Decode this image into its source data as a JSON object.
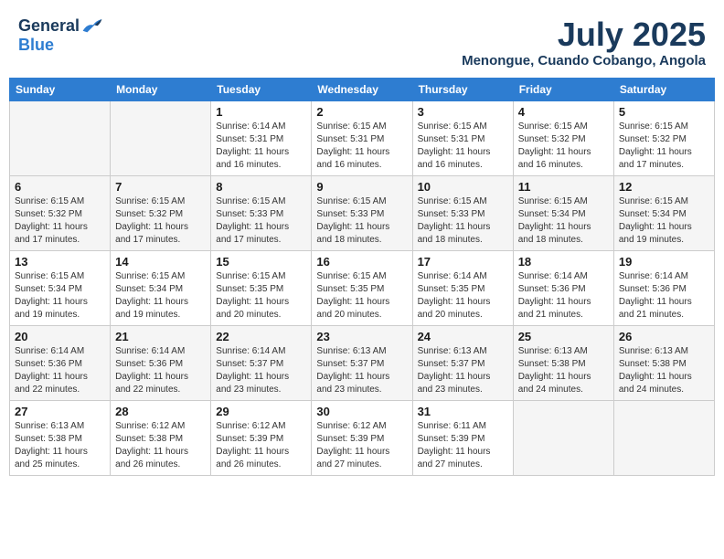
{
  "header": {
    "logo_general": "General",
    "logo_blue": "Blue",
    "month_title": "July 2025",
    "location": "Menongue, Cuando Cobango, Angola"
  },
  "weekdays": [
    "Sunday",
    "Monday",
    "Tuesday",
    "Wednesday",
    "Thursday",
    "Friday",
    "Saturday"
  ],
  "weeks": [
    [
      {
        "day": "",
        "info": ""
      },
      {
        "day": "",
        "info": ""
      },
      {
        "day": "1",
        "info": "Sunrise: 6:14 AM\nSunset: 5:31 PM\nDaylight: 11 hours and 16 minutes."
      },
      {
        "day": "2",
        "info": "Sunrise: 6:15 AM\nSunset: 5:31 PM\nDaylight: 11 hours and 16 minutes."
      },
      {
        "day": "3",
        "info": "Sunrise: 6:15 AM\nSunset: 5:31 PM\nDaylight: 11 hours and 16 minutes."
      },
      {
        "day": "4",
        "info": "Sunrise: 6:15 AM\nSunset: 5:32 PM\nDaylight: 11 hours and 16 minutes."
      },
      {
        "day": "5",
        "info": "Sunrise: 6:15 AM\nSunset: 5:32 PM\nDaylight: 11 hours and 17 minutes."
      }
    ],
    [
      {
        "day": "6",
        "info": "Sunrise: 6:15 AM\nSunset: 5:32 PM\nDaylight: 11 hours and 17 minutes."
      },
      {
        "day": "7",
        "info": "Sunrise: 6:15 AM\nSunset: 5:32 PM\nDaylight: 11 hours and 17 minutes."
      },
      {
        "day": "8",
        "info": "Sunrise: 6:15 AM\nSunset: 5:33 PM\nDaylight: 11 hours and 17 minutes."
      },
      {
        "day": "9",
        "info": "Sunrise: 6:15 AM\nSunset: 5:33 PM\nDaylight: 11 hours and 18 minutes."
      },
      {
        "day": "10",
        "info": "Sunrise: 6:15 AM\nSunset: 5:33 PM\nDaylight: 11 hours and 18 minutes."
      },
      {
        "day": "11",
        "info": "Sunrise: 6:15 AM\nSunset: 5:34 PM\nDaylight: 11 hours and 18 minutes."
      },
      {
        "day": "12",
        "info": "Sunrise: 6:15 AM\nSunset: 5:34 PM\nDaylight: 11 hours and 19 minutes."
      }
    ],
    [
      {
        "day": "13",
        "info": "Sunrise: 6:15 AM\nSunset: 5:34 PM\nDaylight: 11 hours and 19 minutes."
      },
      {
        "day": "14",
        "info": "Sunrise: 6:15 AM\nSunset: 5:34 PM\nDaylight: 11 hours and 19 minutes."
      },
      {
        "day": "15",
        "info": "Sunrise: 6:15 AM\nSunset: 5:35 PM\nDaylight: 11 hours and 20 minutes."
      },
      {
        "day": "16",
        "info": "Sunrise: 6:15 AM\nSunset: 5:35 PM\nDaylight: 11 hours and 20 minutes."
      },
      {
        "day": "17",
        "info": "Sunrise: 6:14 AM\nSunset: 5:35 PM\nDaylight: 11 hours and 20 minutes."
      },
      {
        "day": "18",
        "info": "Sunrise: 6:14 AM\nSunset: 5:36 PM\nDaylight: 11 hours and 21 minutes."
      },
      {
        "day": "19",
        "info": "Sunrise: 6:14 AM\nSunset: 5:36 PM\nDaylight: 11 hours and 21 minutes."
      }
    ],
    [
      {
        "day": "20",
        "info": "Sunrise: 6:14 AM\nSunset: 5:36 PM\nDaylight: 11 hours and 22 minutes."
      },
      {
        "day": "21",
        "info": "Sunrise: 6:14 AM\nSunset: 5:36 PM\nDaylight: 11 hours and 22 minutes."
      },
      {
        "day": "22",
        "info": "Sunrise: 6:14 AM\nSunset: 5:37 PM\nDaylight: 11 hours and 23 minutes."
      },
      {
        "day": "23",
        "info": "Sunrise: 6:13 AM\nSunset: 5:37 PM\nDaylight: 11 hours and 23 minutes."
      },
      {
        "day": "24",
        "info": "Sunrise: 6:13 AM\nSunset: 5:37 PM\nDaylight: 11 hours and 23 minutes."
      },
      {
        "day": "25",
        "info": "Sunrise: 6:13 AM\nSunset: 5:38 PM\nDaylight: 11 hours and 24 minutes."
      },
      {
        "day": "26",
        "info": "Sunrise: 6:13 AM\nSunset: 5:38 PM\nDaylight: 11 hours and 24 minutes."
      }
    ],
    [
      {
        "day": "27",
        "info": "Sunrise: 6:13 AM\nSunset: 5:38 PM\nDaylight: 11 hours and 25 minutes."
      },
      {
        "day": "28",
        "info": "Sunrise: 6:12 AM\nSunset: 5:38 PM\nDaylight: 11 hours and 26 minutes."
      },
      {
        "day": "29",
        "info": "Sunrise: 6:12 AM\nSunset: 5:39 PM\nDaylight: 11 hours and 26 minutes."
      },
      {
        "day": "30",
        "info": "Sunrise: 6:12 AM\nSunset: 5:39 PM\nDaylight: 11 hours and 27 minutes."
      },
      {
        "day": "31",
        "info": "Sunrise: 6:11 AM\nSunset: 5:39 PM\nDaylight: 11 hours and 27 minutes."
      },
      {
        "day": "",
        "info": ""
      },
      {
        "day": "",
        "info": ""
      }
    ]
  ]
}
